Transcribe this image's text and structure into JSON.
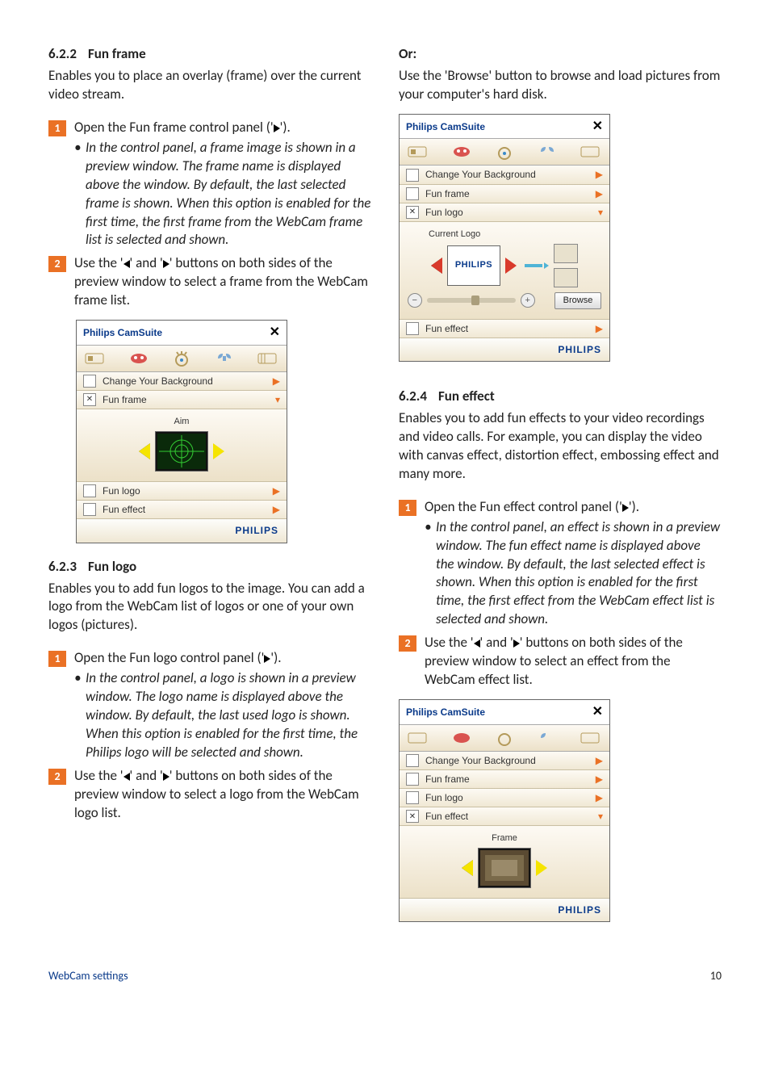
{
  "left": {
    "s1": {
      "num": "6.2.2",
      "title": "Fun frame",
      "intro": "Enables you to place an overlay (frame) over the current video stream.",
      "step1": "Open the Fun frame control panel ('",
      "step1_tail": "').",
      "step1_bullet": "In the control panel, a frame image is shown in a preview window.  The frame name is displayed above the window.  By default, the last selected frame is shown.  When this option is enabled for the first time, the first frame from the WebCam frame list is selected and shown.",
      "step2a": "Use the '",
      "step2b": "' and '",
      "step2c": "' buttons on both sides of the preview window to select a frame from the WebCam frame list."
    },
    "panel1": {
      "title": "Philips CamSuite",
      "row1": "Change Your Background",
      "row2": "Fun frame",
      "preview_label": "Aim",
      "row3": "Fun logo",
      "row4": "Fun effect",
      "brand": "PHILIPS"
    },
    "s2": {
      "num": "6.2.3",
      "title": "Fun logo",
      "intro": "Enables you to add fun logos to the image.  You can add a logo from the WebCam list of logos or one of your own logos (pictures).",
      "step1": "Open the Fun logo control panel ('",
      "step1_tail": "').",
      "step1_bullet": "In the control panel, a logo is shown in a preview window.  The logo name is displayed above the window. By default, the last used logo is shown.  When this option is enabled for the first time, the Philips logo will be selected and shown.",
      "step2a": "Use the '",
      "step2b": "' and '",
      "step2c": "' buttons on both sides of the preview window to select a logo from the WebCam logo list."
    }
  },
  "right": {
    "or_title": "Or:",
    "or_body": "Use the 'Browse' button to browse and load pictures from your computer's hard disk.",
    "panel2": {
      "title": "Philips CamSuite",
      "row1": "Change Your Background",
      "row2": "Fun frame",
      "row3": "Fun logo",
      "preview_label": "Current Logo",
      "logo_text": "PHILIPS",
      "browse": "Browse",
      "row4": "Fun effect",
      "brand": "PHILIPS"
    },
    "s3": {
      "num": "6.2.4",
      "title": "Fun effect",
      "intro": "Enables you to add fun effects to your video recordings and video calls. For example, you can display the video with canvas effect, distortion effect, embossing effect and many more.",
      "step1": "Open the Fun effect control panel ('",
      "step1_tail": "').",
      "step1_bullet": "In the control panel, an effect is shown in a preview window.  The fun effect name is displayed above the window. By default, the last selected effect is shown.  When this option is enabled for the first time, the first effect from the WebCam effect list is selected and shown.",
      "step2a": "Use the '",
      "step2b": "' and '",
      "step2c": "' buttons on both sides of the preview window to select an effect from the WebCam effect list."
    },
    "panel3": {
      "title": "Philips CamSuite",
      "row1": "Change Your Background",
      "row2": "Fun frame",
      "row3": "Fun logo",
      "row4": "Fun effect",
      "preview_label": "Frame",
      "brand": "PHILIPS"
    }
  },
  "footer": {
    "section": "WebCam settings",
    "page": "10"
  }
}
